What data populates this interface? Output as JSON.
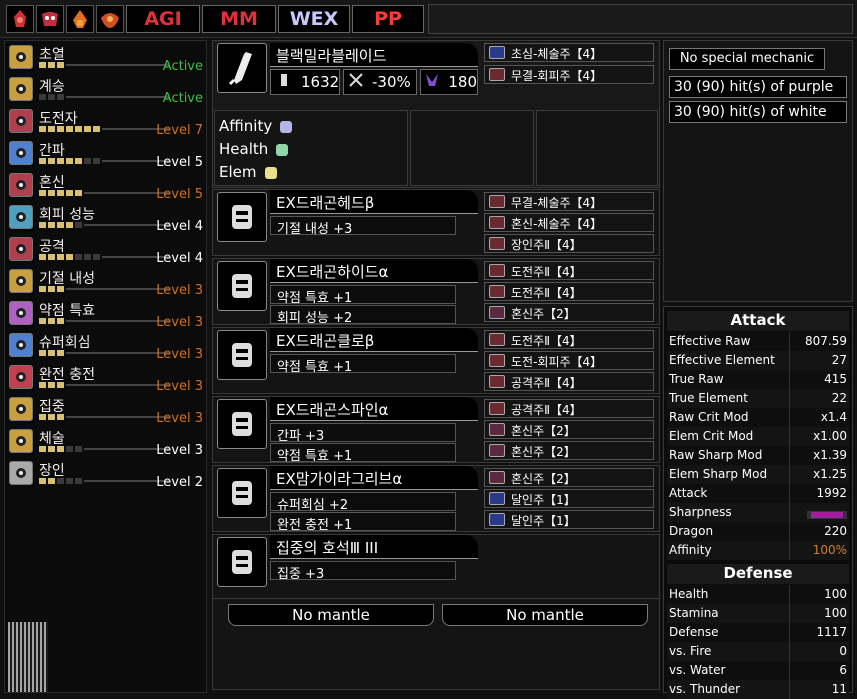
{
  "topbar": {
    "icons": [
      "monster-icon-1",
      "monster-icon-2",
      "monster-icon-3",
      "monster-icon-4"
    ],
    "buttons": [
      "AGI",
      "MM",
      "WEX",
      "PP"
    ]
  },
  "skills": [
    {
      "name": "초열",
      "pips": 3,
      "max": 3,
      "level": "Active",
      "color": "#40c040"
    },
    {
      "name": "계승",
      "pips": 0,
      "max": 3,
      "level": "Active",
      "color": "#40c040"
    },
    {
      "name": "도전자",
      "pips": 7,
      "max": 7,
      "level": "Level 7",
      "color": "#d07020"
    },
    {
      "name": "간파",
      "pips": 5,
      "max": 7,
      "level": "Level 5",
      "color": "#ffffff"
    },
    {
      "name": "혼신",
      "pips": 5,
      "max": 5,
      "level": "Level 5",
      "color": "#d07020"
    },
    {
      "name": "회피 성능",
      "pips": 4,
      "max": 5,
      "level": "Level 4",
      "color": "#ffffff"
    },
    {
      "name": "공격",
      "pips": 4,
      "max": 7,
      "level": "Level 4",
      "color": "#ffffff"
    },
    {
      "name": "기절 내성",
      "pips": 3,
      "max": 3,
      "level": "Level 3",
      "color": "#d07020"
    },
    {
      "name": "약점 특효",
      "pips": 3,
      "max": 3,
      "level": "Level 3",
      "color": "#d07020"
    },
    {
      "name": "슈퍼회심",
      "pips": 3,
      "max": 3,
      "level": "Level 3",
      "color": "#d07020"
    },
    {
      "name": "완전 충전",
      "pips": 3,
      "max": 3,
      "level": "Level 3",
      "color": "#d07020"
    },
    {
      "name": "집중",
      "pips": 3,
      "max": 3,
      "level": "Level 3",
      "color": "#d07020"
    },
    {
      "name": "체술",
      "pips": 3,
      "max": 5,
      "level": "Level 3",
      "color": "#ffffff"
    },
    {
      "name": "장인",
      "pips": 2,
      "max": 5,
      "level": "Level 2",
      "color": "#ffffff"
    }
  ],
  "weapon": {
    "name": "블랙밀라블레이드",
    "attack": "1632",
    "affinity": "-30%",
    "element": "180",
    "decos": [
      "초심-체술주【4】",
      "무결-회피주【4】"
    ],
    "attrs": {
      "affinity": "Affinity",
      "health": "Health",
      "elem": "Elem"
    }
  },
  "armor": [
    {
      "name": "EXDRAGON_HEAD",
      "label": "EX드래곤헤드β",
      "skills": [
        "기절 내성 +3"
      ],
      "decos": [
        "무결-체술주【4】",
        "혼신-체술주【4】",
        "장인주Ⅱ【4】"
      ]
    },
    {
      "name": "EXDRAGON_CHEST",
      "label": "EX드래곤하이드α",
      "skills": [
        "약점 특효 +1",
        "회피 성능 +2"
      ],
      "decos": [
        "도전주Ⅱ【4】",
        "도전주Ⅱ【4】",
        "혼신주【2】"
      ]
    },
    {
      "name": "EXDRAGON_ARMS",
      "label": "EX드래곤클로β",
      "skills": [
        "약점 특효 +1"
      ],
      "decos": [
        "도전주Ⅱ【4】",
        "도전-회피주【4】",
        "공격주Ⅱ【4】"
      ]
    },
    {
      "name": "EXDRAGON_WAIST",
      "label": "EX드래곤스파인α",
      "skills": [
        "간파 +3",
        "약점 특효 +1"
      ],
      "decos": [
        "공격주Ⅱ【4】",
        "혼신주【2】",
        "혼신주【2】"
      ]
    },
    {
      "name": "EXDRAGON_LEGS",
      "label": "EX맘가이라그리브α",
      "skills": [
        "슈퍼회심 +2",
        "완전 충전 +1"
      ],
      "decos": [
        "혼신주【2】",
        "달인주【1】",
        "달인주【1】"
      ]
    },
    {
      "name": "CHARM",
      "label": "집중의 호석Ⅲ III",
      "skills": [
        "집중 +3"
      ],
      "decos": []
    }
  ],
  "mantles": [
    "No mantle",
    "No mantle"
  ],
  "mechanic": {
    "title": "No special mechanic",
    "line1": "30 (90) hit(s) of purple",
    "line2": "30 (90) hit(s) of white"
  },
  "attack_section": {
    "title": "Attack",
    "rows": [
      {
        "label": "Effective Raw",
        "value": "807.59"
      },
      {
        "label": "Effective Element",
        "value": "27"
      },
      {
        "label": "True Raw",
        "value": "415"
      },
      {
        "label": "True Element",
        "value": "22"
      },
      {
        "label": "Raw Crit Mod",
        "value": "x1.4"
      },
      {
        "label": "Elem Crit Mod",
        "value": "x1.00"
      },
      {
        "label": "Raw Sharp Mod",
        "value": "x1.39"
      },
      {
        "label": "Elem Sharp Mod",
        "value": "x1.25"
      },
      {
        "label": "Attack",
        "value": "1992"
      },
      {
        "label": "Sharpness",
        "value": ""
      },
      {
        "label": "Dragon",
        "value": "220"
      },
      {
        "label": "Affinity",
        "value": "100%"
      }
    ]
  },
  "defense_section": {
    "title": "Defense",
    "rows": [
      {
        "label": "Health",
        "value": "100"
      },
      {
        "label": "Stamina",
        "value": "100"
      },
      {
        "label": "Defense",
        "value": "1117"
      },
      {
        "label": "vs. Fire",
        "value": "0"
      },
      {
        "label": "vs. Water",
        "value": "6"
      },
      {
        "label": "vs. Thunder",
        "value": "11"
      }
    ]
  },
  "colors": {
    "affinity_hex": "#b4b4e6",
    "health_hex": "#8fd6a8",
    "elem_hex": "#e8e08a",
    "active": "#40c040",
    "maxed": "#d07020"
  }
}
